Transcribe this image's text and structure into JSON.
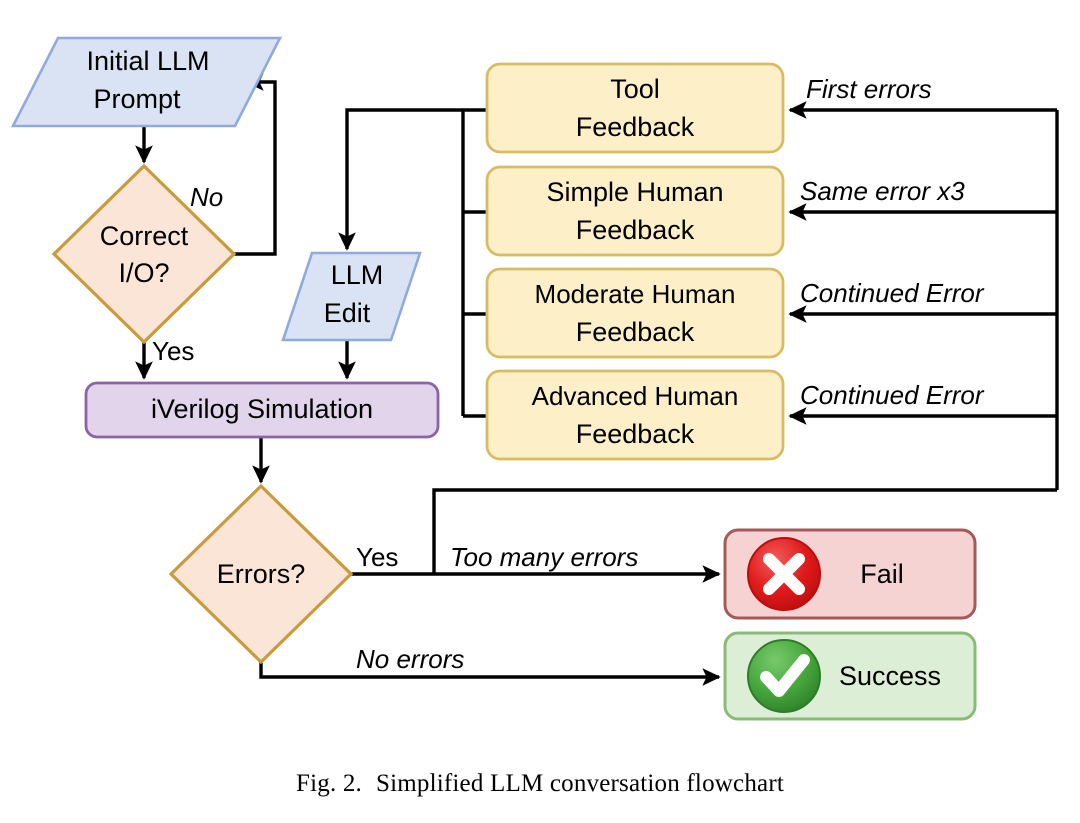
{
  "figure": {
    "caption_number": "Fig. 2.",
    "caption_text": "Simplified LLM conversation flowchart"
  },
  "colors": {
    "io_fill": "#dae3f3",
    "io_stroke": "#8faadc",
    "decision_fill": "#fbe5d6",
    "decision_stroke": "#c89b3c",
    "process_fill": "#e2d4ea",
    "process_stroke": "#8a63a8",
    "feedback_fill": "#fdf0c9",
    "feedback_stroke": "#d6bd62",
    "fail_fill": "#f5d3d3",
    "fail_stroke": "#a65959",
    "success_fill": "#ddeed6",
    "success_stroke": "#8cbb78",
    "fail_icon": "#e01b1b",
    "success_icon": "#3d9b35",
    "line": "#000000"
  },
  "nodes": {
    "initial_prompt": {
      "line1": "Initial LLM",
      "line2": "Prompt",
      "shape": "parallelogram"
    },
    "correct_io": {
      "line1": "Correct",
      "line2": "I/O?",
      "shape": "diamond"
    },
    "llm_edit": {
      "line1": "LLM",
      "line2": "Edit",
      "shape": "parallelogram"
    },
    "iverilog": {
      "line1": "iVerilog Simulation",
      "shape": "rounded-rect"
    },
    "errors": {
      "line1": "Errors?",
      "shape": "diamond"
    },
    "fail": {
      "label": "Fail",
      "icon": "x-circle-icon"
    },
    "success": {
      "label": "Success",
      "icon": "check-circle-icon"
    }
  },
  "feedback_boxes": [
    {
      "line1": "Tool",
      "line2": "Feedback",
      "trigger": "First errors"
    },
    {
      "line1": "Simple Human",
      "line2": "Feedback",
      "trigger": "Same error x3"
    },
    {
      "line1": "Moderate Human",
      "line2": "Feedback",
      "trigger": "Continued Error"
    },
    {
      "line1": "Advanced Human",
      "line2": "Feedback",
      "trigger": "Continued Error"
    }
  ],
  "edge_labels": {
    "correct_io_no": "No",
    "correct_io_yes": "Yes",
    "errors_yes": "Yes",
    "too_many_errors": "Too many errors",
    "no_errors": "No errors"
  }
}
